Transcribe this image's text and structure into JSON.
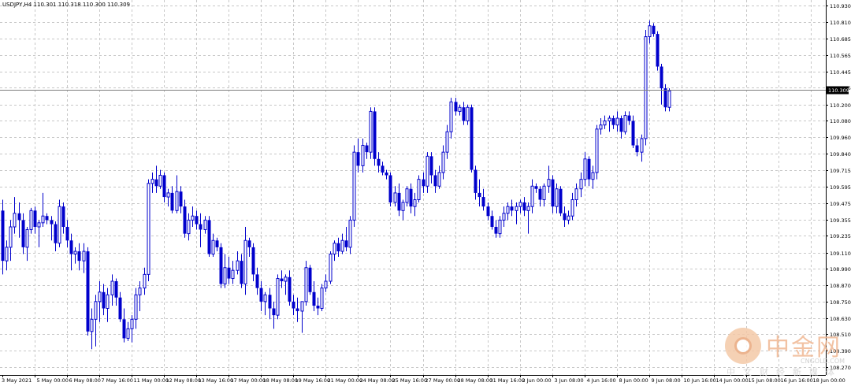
{
  "symbol_info": "USDJPY,H4  110.301 110.318 110.300 110.309",
  "watermark": {
    "brand_cn": "中金网",
    "brand_en": "CNGOLD.COM",
    "sub_cn": "中文财经新媒体"
  },
  "colors": {
    "candle": "#0000cc",
    "grid": "#c8c8c8",
    "axis": "#000000",
    "price_line": "#7f7f7f",
    "label_bg": "#000000"
  },
  "chart_data": {
    "type": "candlestick",
    "symbol": "USDJPY",
    "timeframe": "H4",
    "y_axis": {
      "ticks": [
        110.93,
        110.81,
        110.685,
        110.565,
        110.445,
        110.325,
        110.2,
        110.08,
        109.96,
        109.84,
        109.715,
        109.595,
        109.475,
        109.355,
        109.235,
        109.11,
        108.99,
        108.87,
        108.75,
        108.63,
        108.51,
        108.39,
        108.27
      ],
      "tick_labels": [
        "110.930",
        "110.810",
        "110.685",
        "110.565",
        "110.445",
        "110.325",
        "110.200",
        "110.080",
        "109.960",
        "109.840",
        "109.715",
        "109.595",
        "109.475",
        "109.355",
        "109.235",
        "109.110",
        "108.990",
        "108.870",
        "108.750",
        "108.630",
        "108.510",
        "108.390",
        "108.270"
      ],
      "range": [
        108.21,
        110.97
      ]
    },
    "x_axis": {
      "tick_labels": [
        "3 May 2021",
        "5 May 00:00",
        "6 May 08:00",
        "7 May 16:00",
        "11 May 00:00",
        "12 May 08:00",
        "13 May 16:00",
        "17 May 00:00",
        "18 May 08:00",
        "19 May 16:00",
        "21 May 00:00",
        "24 May 08:00",
        "25 May 16:00",
        "27 May 00:00",
        "28 May 08:00",
        "31 May 16:00",
        "2 Jun 00:00",
        "3 Jun 08:00",
        "4 Jun 16:00",
        "8 Jun 00:00",
        "9 Jun 08:00",
        "10 Jun 16:00",
        "14 Jun 00:00",
        "15 Jun 08:00",
        "16 Jun 16:00",
        "18 Jun 00:00"
      ],
      "tick_bar_index": [
        0,
        8,
        16,
        24,
        32,
        40,
        48,
        56,
        64,
        72,
        80,
        88,
        96,
        104,
        112,
        120,
        128,
        136,
        144,
        152,
        160,
        168,
        176,
        184,
        192,
        200
      ]
    },
    "current_price": "110.309",
    "candles": [
      [
        109.42,
        109.5,
        108.95,
        109.05
      ],
      [
        109.05,
        109.2,
        108.98,
        109.15
      ],
      [
        109.15,
        109.35,
        109.05,
        109.3
      ],
      [
        109.3,
        109.52,
        109.25,
        109.4
      ],
      [
        109.4,
        109.48,
        109.22,
        109.35
      ],
      [
        109.35,
        109.4,
        109.1,
        109.15
      ],
      [
        109.15,
        109.3,
        109.05,
        109.28
      ],
      [
        109.28,
        109.44,
        109.25,
        109.42
      ],
      [
        109.42,
        109.45,
        109.25,
        109.3
      ],
      [
        109.3,
        109.35,
        109.15,
        109.33
      ],
      [
        109.33,
        109.55,
        109.3,
        109.38
      ],
      [
        109.38,
        109.4,
        109.32,
        109.35
      ],
      [
        109.35,
        109.38,
        109.2,
        109.32
      ],
      [
        109.32,
        109.34,
        109.12,
        109.18
      ],
      [
        109.18,
        109.5,
        109.15,
        109.45
      ],
      [
        109.45,
        109.48,
        109.25,
        109.3
      ],
      [
        109.3,
        109.35,
        109.15,
        109.2
      ],
      [
        109.2,
        109.25,
        108.98,
        109.1
      ],
      [
        109.1,
        109.15,
        109.03,
        109.12
      ],
      [
        109.12,
        109.18,
        108.98,
        109.05
      ],
      [
        109.05,
        109.18,
        108.96,
        109.12
      ],
      [
        109.12,
        109.15,
        108.5,
        108.53
      ],
      [
        108.53,
        108.7,
        108.4,
        108.62
      ],
      [
        108.62,
        108.8,
        108.42,
        108.75
      ],
      [
        108.75,
        108.9,
        108.6,
        108.82
      ],
      [
        108.82,
        108.88,
        108.65,
        108.7
      ],
      [
        108.7,
        108.85,
        108.6,
        108.8
      ],
      [
        108.8,
        108.95,
        108.72,
        108.9
      ],
      [
        108.9,
        108.92,
        108.72,
        108.78
      ],
      [
        108.78,
        108.82,
        108.6,
        108.62
      ],
      [
        108.62,
        108.7,
        108.45,
        108.48
      ],
      [
        108.48,
        108.6,
        108.46,
        108.55
      ],
      [
        108.55,
        108.65,
        108.45,
        108.62
      ],
      [
        108.62,
        108.85,
        108.55,
        108.8
      ],
      [
        108.8,
        108.9,
        108.68,
        108.85
      ],
      [
        108.85,
        109.0,
        108.8,
        108.95
      ],
      [
        108.95,
        109.65,
        108.9,
        109.62
      ],
      [
        109.62,
        109.7,
        109.55,
        109.65
      ],
      [
        109.65,
        109.75,
        109.55,
        109.6
      ],
      [
        109.6,
        109.72,
        109.58,
        109.68
      ],
      [
        109.68,
        109.7,
        109.48,
        109.52
      ],
      [
        109.52,
        109.58,
        109.45,
        109.55
      ],
      [
        109.55,
        109.6,
        109.4,
        109.42
      ],
      [
        109.42,
        109.68,
        109.4,
        109.56
      ],
      [
        109.56,
        109.6,
        109.4,
        109.45
      ],
      [
        109.45,
        109.5,
        109.22,
        109.25
      ],
      [
        109.25,
        109.4,
        109.2,
        109.35
      ],
      [
        109.35,
        109.45,
        109.3,
        109.38
      ],
      [
        109.38,
        109.42,
        109.28,
        109.32
      ],
      [
        109.32,
        109.4,
        109.15,
        109.28
      ],
      [
        109.28,
        109.38,
        109.25,
        109.35
      ],
      [
        109.35,
        109.38,
        109.08,
        109.1
      ],
      [
        109.1,
        109.25,
        109.08,
        109.2
      ],
      [
        109.2,
        109.22,
        109.12,
        109.15
      ],
      [
        109.15,
        109.18,
        108.85,
        108.88
      ],
      [
        108.88,
        109.1,
        108.85,
        109.0
      ],
      [
        109.0,
        109.08,
        108.88,
        108.92
      ],
      [
        108.92,
        109.05,
        108.88,
        108.98
      ],
      [
        108.98,
        109.12,
        108.95,
        109.05
      ],
      [
        109.05,
        109.1,
        108.85,
        108.88
      ],
      [
        108.88,
        109.3,
        108.8,
        109.2
      ],
      [
        109.2,
        109.22,
        109.08,
        109.15
      ],
      [
        109.15,
        109.18,
        108.9,
        108.95
      ],
      [
        108.95,
        109.0,
        108.8,
        108.85
      ],
      [
        108.85,
        108.9,
        108.68,
        108.75
      ],
      [
        108.75,
        108.82,
        108.65,
        108.8
      ],
      [
        108.8,
        108.85,
        108.62,
        108.7
      ],
      [
        108.7,
        108.75,
        108.55,
        108.65
      ],
      [
        108.65,
        108.95,
        108.62,
        108.92
      ],
      [
        108.92,
        108.98,
        108.85,
        108.9
      ],
      [
        108.9,
        108.95,
        108.8,
        108.93
      ],
      [
        108.93,
        108.98,
        108.72,
        108.75
      ],
      [
        108.75,
        108.8,
        108.65,
        108.7
      ],
      [
        108.7,
        108.78,
        108.6,
        108.68
      ],
      [
        108.68,
        108.72,
        108.52,
        108.75
      ],
      [
        108.75,
        109.05,
        108.72,
        109.0
      ],
      [
        109.0,
        109.02,
        108.8,
        108.82
      ],
      [
        108.82,
        108.9,
        108.68,
        108.72
      ],
      [
        108.72,
        108.78,
        108.65,
        108.7
      ],
      [
        108.7,
        108.88,
        108.68,
        108.85
      ],
      [
        108.85,
        108.95,
        108.82,
        108.9
      ],
      [
        108.9,
        109.12,
        108.88,
        109.1
      ],
      [
        109.1,
        109.2,
        109.05,
        109.18
      ],
      [
        109.18,
        109.22,
        109.08,
        109.12
      ],
      [
        109.12,
        109.25,
        109.1,
        109.2
      ],
      [
        109.2,
        109.3,
        109.12,
        109.15
      ],
      [
        109.15,
        109.38,
        109.1,
        109.35
      ],
      [
        109.35,
        109.9,
        109.3,
        109.85
      ],
      [
        109.85,
        109.95,
        109.7,
        109.75
      ],
      [
        109.75,
        109.95,
        109.7,
        109.9
      ],
      [
        109.9,
        109.92,
        109.8,
        109.85
      ],
      [
        109.85,
        110.18,
        109.8,
        110.15
      ],
      [
        110.15,
        110.18,
        109.75,
        109.8
      ],
      [
        109.8,
        109.85,
        109.7,
        109.75
      ],
      [
        109.75,
        109.78,
        109.68,
        109.7
      ],
      [
        109.7,
        109.72,
        109.65,
        109.68
      ],
      [
        109.68,
        109.7,
        109.45,
        109.48
      ],
      [
        109.48,
        109.6,
        109.45,
        109.55
      ],
      [
        109.55,
        109.62,
        109.38,
        109.42
      ],
      [
        109.42,
        109.5,
        109.35,
        109.48
      ],
      [
        109.48,
        109.6,
        109.45,
        109.58
      ],
      [
        109.58,
        109.62,
        109.4,
        109.45
      ],
      [
        109.45,
        109.55,
        109.38,
        109.5
      ],
      [
        109.5,
        109.68,
        109.48,
        109.65
      ],
      [
        109.65,
        109.7,
        109.55,
        109.6
      ],
      [
        109.6,
        109.85,
        109.55,
        109.82
      ],
      [
        109.82,
        109.85,
        109.62,
        109.68
      ],
      [
        109.68,
        109.72,
        109.55,
        109.6
      ],
      [
        109.6,
        109.75,
        109.58,
        109.7
      ],
      [
        109.7,
        109.9,
        109.65,
        109.85
      ],
      [
        109.85,
        110.05,
        109.8,
        110.0
      ],
      [
        110.0,
        110.25,
        109.95,
        110.22
      ],
      [
        110.22,
        110.25,
        110.12,
        110.15
      ],
      [
        110.15,
        110.2,
        110.12,
        110.18
      ],
      [
        110.18,
        110.22,
        110.05,
        110.08
      ],
      [
        110.08,
        110.2,
        110.05,
        110.18
      ],
      [
        110.18,
        110.2,
        109.7,
        109.72
      ],
      [
        109.72,
        109.75,
        109.5,
        109.55
      ],
      [
        109.55,
        109.65,
        109.45,
        109.52
      ],
      [
        109.52,
        109.58,
        109.42,
        109.45
      ],
      [
        109.45,
        109.48,
        109.35,
        109.38
      ],
      [
        109.38,
        109.42,
        109.28,
        109.3
      ],
      [
        109.3,
        109.35,
        109.22,
        109.25
      ],
      [
        109.25,
        109.38,
        109.22,
        109.35
      ],
      [
        109.35,
        109.45,
        109.3,
        109.4
      ],
      [
        109.4,
        109.48,
        109.35,
        109.45
      ],
      [
        109.45,
        109.5,
        109.38,
        109.42
      ],
      [
        109.42,
        109.48,
        109.32,
        109.45
      ],
      [
        109.45,
        109.5,
        109.4,
        109.48
      ],
      [
        109.48,
        109.52,
        109.38,
        109.42
      ],
      [
        109.42,
        109.48,
        109.25,
        109.45
      ],
      [
        109.45,
        109.65,
        109.4,
        109.6
      ],
      [
        109.6,
        109.62,
        109.55,
        109.58
      ],
      [
        109.58,
        109.6,
        109.45,
        109.5
      ],
      [
        109.5,
        109.62,
        109.45,
        109.6
      ],
      [
        109.6,
        109.75,
        109.55,
        109.65
      ],
      [
        109.65,
        109.68,
        109.4,
        109.45
      ],
      [
        109.45,
        109.62,
        109.4,
        109.58
      ],
      [
        109.58,
        109.6,
        109.38,
        109.4
      ],
      [
        109.4,
        109.45,
        109.3,
        109.35
      ],
      [
        109.35,
        109.42,
        109.32,
        109.38
      ],
      [
        109.38,
        109.55,
        109.35,
        109.5
      ],
      [
        109.5,
        109.62,
        109.45,
        109.58
      ],
      [
        109.58,
        109.7,
        109.52,
        109.65
      ],
      [
        109.65,
        109.85,
        109.6,
        109.8
      ],
      [
        109.8,
        109.82,
        109.6,
        109.65
      ],
      [
        109.65,
        109.75,
        109.58,
        109.7
      ],
      [
        109.7,
        110.05,
        109.65,
        110.02
      ],
      [
        110.02,
        110.1,
        109.98,
        110.05
      ],
      [
        110.05,
        110.12,
        110.02,
        110.08
      ],
      [
        110.08,
        110.12,
        110.0,
        110.1
      ],
      [
        110.1,
        110.12,
        110.02,
        110.05
      ],
      [
        110.05,
        110.15,
        110.0,
        110.1
      ],
      [
        110.1,
        110.12,
        109.95,
        110.0
      ],
      [
        110.0,
        110.15,
        109.98,
        110.12
      ],
      [
        110.12,
        110.15,
        110.05,
        110.08
      ],
      [
        110.08,
        110.12,
        109.88,
        109.9
      ],
      [
        109.9,
        109.95,
        109.82,
        109.85
      ],
      [
        109.85,
        109.98,
        109.78,
        109.95
      ],
      [
        109.95,
        110.75,
        109.9,
        110.7
      ],
      [
        110.7,
        110.82,
        110.65,
        110.78
      ],
      [
        110.78,
        110.8,
        110.7,
        110.72
      ],
      [
        110.72,
        110.74,
        110.45,
        110.48
      ],
      [
        110.48,
        110.5,
        110.2,
        110.32
      ],
      [
        110.32,
        110.35,
        110.15,
        110.18
      ],
      [
        110.18,
        110.32,
        110.15,
        110.3
      ]
    ]
  }
}
